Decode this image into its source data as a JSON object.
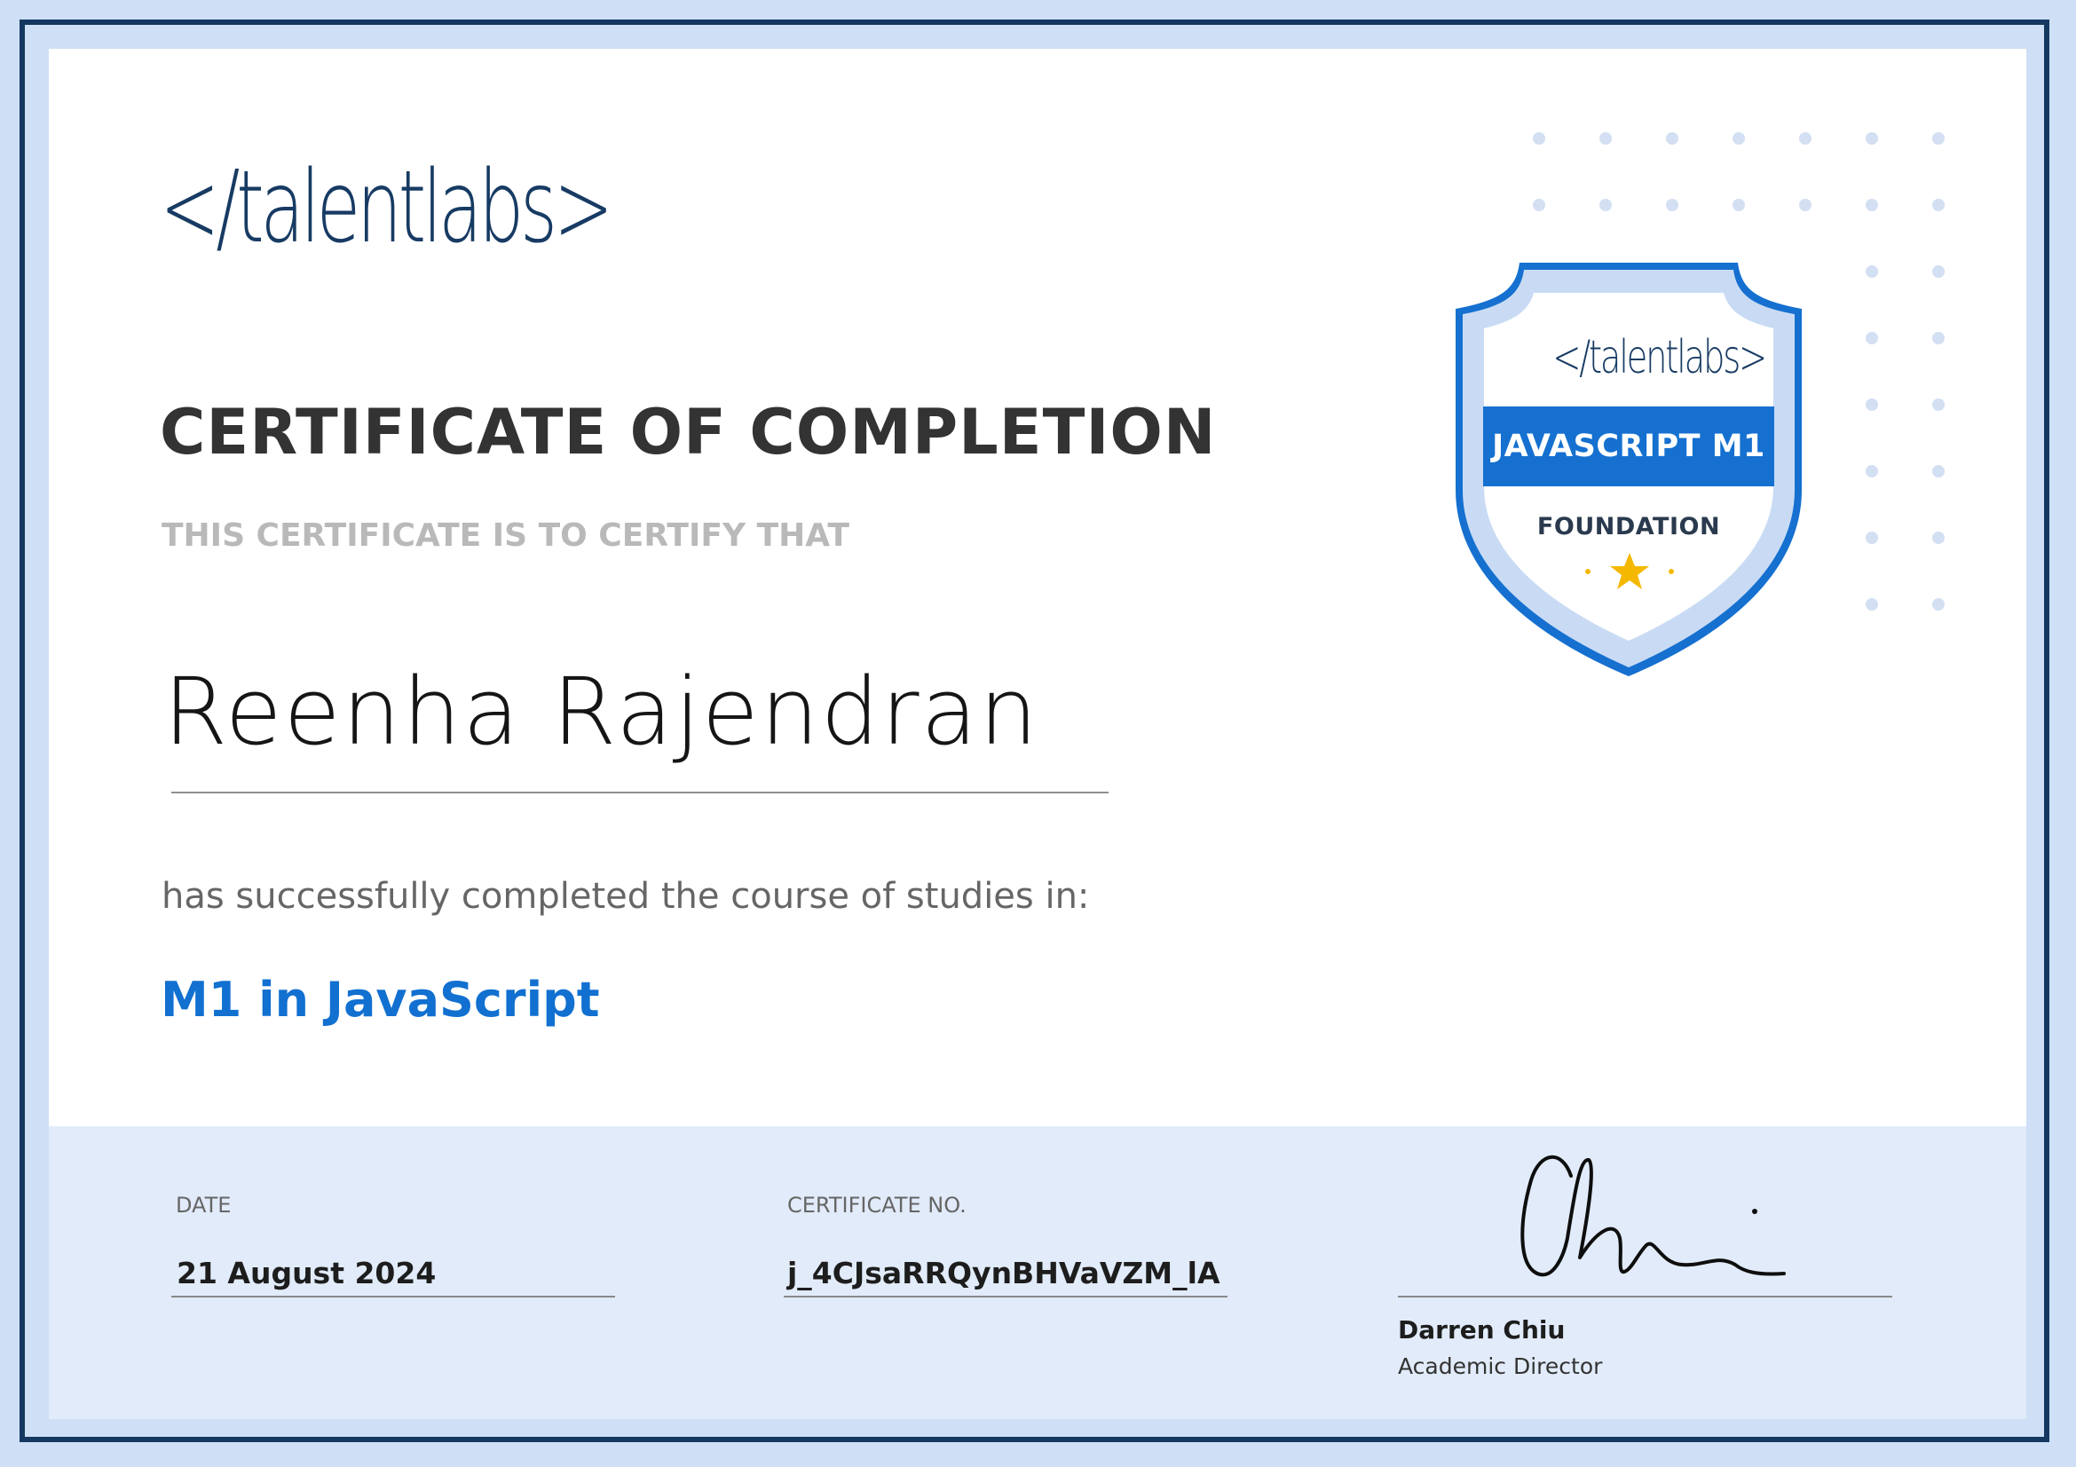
{
  "logo": {
    "text": "</talentlabs>"
  },
  "certificate": {
    "title": "CERTIFICATE OF COMPLETION",
    "subtitle": "THIS CERTIFICATE IS TO CERTIFY THAT",
    "recipient_name": "Reenha Rajendran",
    "completion_text": "has successfully completed the course of studies  in:",
    "course_name": "M1 in JavaScript"
  },
  "badge": {
    "logo_text": "</talentlabs>",
    "course": "JAVASCRIPT M1",
    "level": "FOUNDATION",
    "icon": "star-icon"
  },
  "footer": {
    "date_label": "DATE",
    "date_value": "21 August 2024",
    "cert_no_label": "CERTIFICATE NO.",
    "cert_no_value": "j_4CJsaRRQynBHVaVZM_lA",
    "signer_name": "Darren Chiu",
    "signer_title": "Academic Director"
  },
  "colors": {
    "border_dark": "#14385f",
    "border_light": "#cfe0f6",
    "accent_blue": "#1570d0",
    "footer_bg": "#e1ebf9",
    "star": "#f5b800"
  }
}
